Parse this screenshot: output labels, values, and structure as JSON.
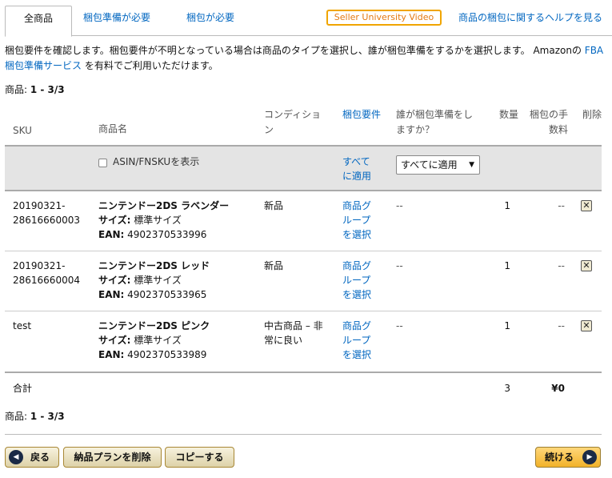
{
  "tabs": {
    "all": "全商品",
    "prep_required": "梱包準備が必要",
    "packing_required": "梱包が必要",
    "seller_university": "Seller University Video",
    "help": "商品の梱包に関するヘルプを見る"
  },
  "intro": {
    "text": "梱包要件を確認します。梱包要件が不明となっている場合は商品のタイプを選択し、誰が梱包準備をするかを選択します。 Amazonの",
    "link": "FBA梱包準備サービス",
    "text2": "を有料でご利用いただけます。"
  },
  "count_top": {
    "label": "商品:",
    "value": "1 - 3/3"
  },
  "count_bottom": {
    "label": "商品:",
    "value": "1 - 3/3"
  },
  "table": {
    "headers": {
      "sku": "SKU",
      "name": "商品名",
      "condition": "コンディション",
      "prep_req": "梱包要件",
      "who_prep": "誰が梱包準備をしますか？",
      "qty": "数量",
      "fee": "梱包の手数料",
      "delete": "削除"
    },
    "filter": {
      "show_asin": "ASIN/FNSKUを表示",
      "apply_all_link": "すべてに適用",
      "apply_all_select": "すべてに適用"
    },
    "rows": [
      {
        "sku1": "20190321-",
        "sku2": "28616660003",
        "name": "ニンテンドー2DS ラベンダー",
        "size_label": "サイズ:",
        "size": "標準サイズ",
        "ean_label": "EAN:",
        "ean": "4902370533996",
        "condition": "新品",
        "condition2": "",
        "prep_link": "商品グループを選択",
        "who": "--",
        "qty": "1",
        "fee": "--"
      },
      {
        "sku1": "20190321-",
        "sku2": "28616660004",
        "name": "ニンテンドー2DS レッド",
        "size_label": "サイズ:",
        "size": "標準サイズ",
        "ean_label": "EAN:",
        "ean": "4902370533965",
        "condition": "新品",
        "condition2": "",
        "prep_link": "商品グループを選択",
        "who": "--",
        "qty": "1",
        "fee": "--"
      },
      {
        "sku1": "test",
        "sku2": "",
        "name": "ニンテンドー2DS ピンク",
        "size_label": "サイズ:",
        "size": "標準サイズ",
        "ean_label": "EAN:",
        "ean": "4902370533989",
        "condition": "中古商品 – 非",
        "condition2": "常に良い",
        "prep_link": "商品グループを選択",
        "who": "--",
        "qty": "1",
        "fee": "--"
      }
    ],
    "total": {
      "label": "合計",
      "qty": "3",
      "fee": "¥0"
    }
  },
  "buttons": {
    "back": "戻る",
    "delete_plan": "納品プランを削除",
    "copy": "コピーする",
    "continue": "続ける"
  }
}
